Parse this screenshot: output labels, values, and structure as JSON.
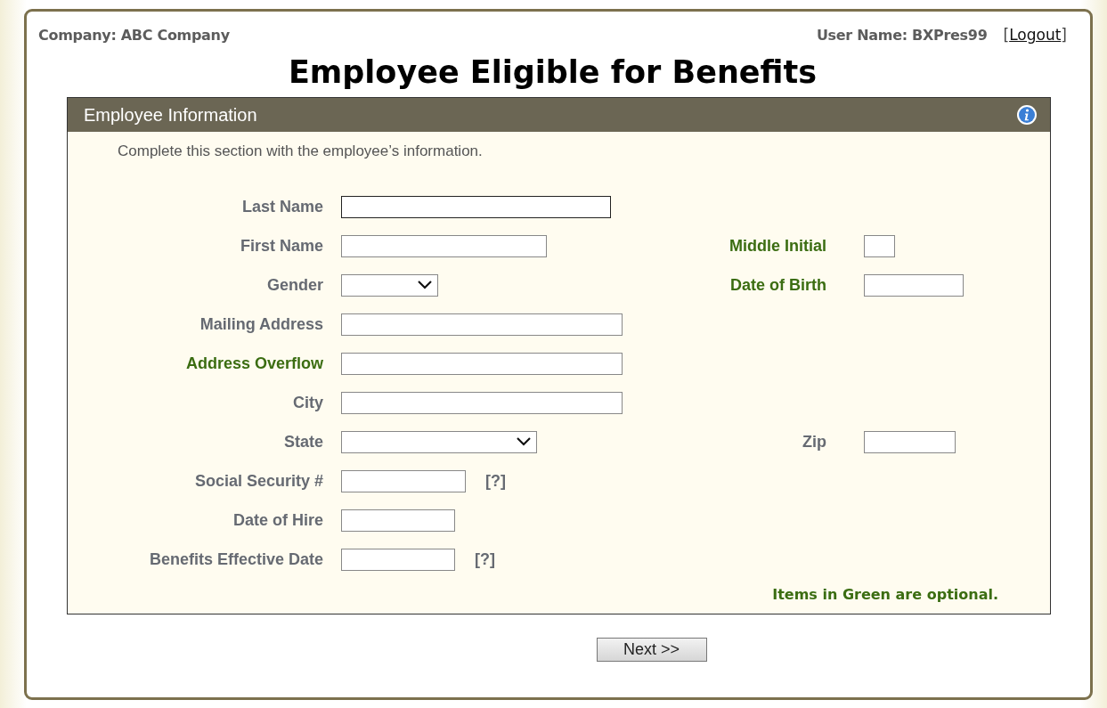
{
  "header": {
    "company": "Company: ABC Company",
    "user": "User Name: BXPres99",
    "logout_open": "[",
    "logout": "Logout",
    "logout_close": "]"
  },
  "title": "Employee Eligible for Benefits",
  "panel": {
    "title": "Employee Information",
    "intro": "Complete this section with the employee’s information.",
    "rows": [
      {
        "left": {
          "label": "Last Name",
          "kind": "text",
          "optional": false,
          "focused": true
        }
      },
      {
        "left": {
          "label": "First Name",
          "kind": "text",
          "optional": false,
          "focused": false
        },
        "right": {
          "label": "Middle Initial",
          "kind": "text",
          "optional": true,
          "focused": false
        }
      },
      {
        "left": {
          "label": "Gender",
          "kind": "select",
          "optional": false,
          "focused": false
        },
        "right": {
          "label": "Date of Birth",
          "kind": "text",
          "optional": true,
          "focused": false
        }
      },
      {
        "left": {
          "label": "Mailing Address",
          "kind": "text",
          "optional": false,
          "focused": false
        }
      },
      {
        "left": {
          "label": "Address Overflow",
          "kind": "text",
          "optional": true,
          "focused": false
        }
      },
      {
        "left": {
          "label": "City",
          "kind": "text",
          "optional": false,
          "focused": false
        }
      },
      {
        "left": {
          "label": "State",
          "kind": "select",
          "optional": false,
          "focused": false
        },
        "right": {
          "label": "Zip",
          "kind": "text",
          "optional": false,
          "focused": false
        }
      },
      {
        "left": {
          "label": "Social Security #",
          "kind": "text",
          "optional": false,
          "focused": false,
          "help": "[?]"
        }
      },
      {
        "left": {
          "label": "Date of Hire",
          "kind": "text",
          "optional": false,
          "focused": false
        }
      },
      {
        "left": {
          "label": "Benefits Effective Date",
          "kind": "text",
          "optional": false,
          "focused": false,
          "help": "[?]"
        }
      }
    ],
    "note": "Items in Green are optional."
  },
  "buttons": [
    "Next >>"
  ]
}
